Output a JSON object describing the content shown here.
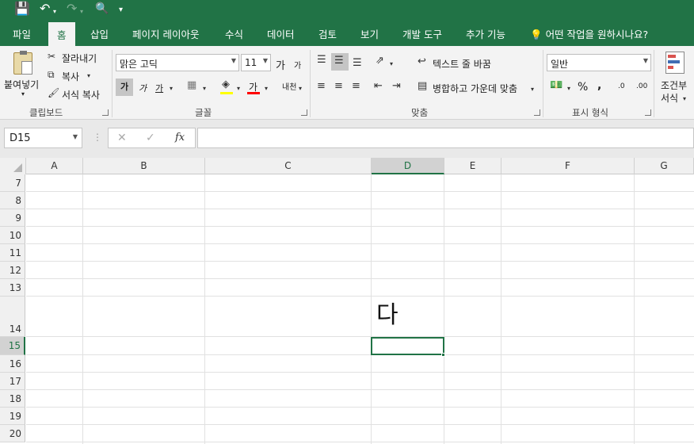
{
  "quick_access": {
    "save_icon": "save-icon",
    "undo_icon": "undo-icon",
    "redo_icon": "redo-icon",
    "preview_icon": "print-preview-icon",
    "customize_icon": "customize-icon"
  },
  "tabs": [
    "파일",
    "홈",
    "삽입",
    "페이지 레이아웃",
    "수식",
    "데이터",
    "검토",
    "보기",
    "개발 도구",
    "추가 기능"
  ],
  "tell_me": "어떤 작업을 원하시나요?",
  "clipboard": {
    "paste": "붙여넣기",
    "cut": "잘라내기",
    "copy": "복사",
    "format_painter": "서식 복사",
    "group": "클립보드"
  },
  "font": {
    "name": "맑은 고딕",
    "size": "11",
    "grow": "가",
    "shrink": "가",
    "bold": "가",
    "italic": "가",
    "underline": "가",
    "color": "가",
    "phonetic": "내천",
    "group": "글꼴"
  },
  "alignment": {
    "wrap_text": "텍스트 줄 바꿈",
    "merge_center": "병합하고 가운데 맞춤",
    "group": "맞춤"
  },
  "number": {
    "format": "일반",
    "percent": "%",
    "comma": ",",
    "increase_decimal": ".0",
    "decrease_decimal": ".00",
    "group": "표시 형식"
  },
  "styles": {
    "conditional_line1": "조건부",
    "conditional_line2": "서식"
  },
  "formula_bar": {
    "name_box": "D15",
    "fx": "fx",
    "cancel": "✕",
    "enter": "✓",
    "value": ""
  },
  "columns": [
    "A",
    "B",
    "C",
    "D",
    "E",
    "F",
    "G"
  ],
  "rows": [
    "7",
    "8",
    "9",
    "10",
    "11",
    "12",
    "13",
    "14",
    "15",
    "16",
    "17",
    "18",
    "19",
    "20"
  ],
  "cells": {
    "D14": "다"
  },
  "colors": {
    "accent": "#217346",
    "highlight_yellow": "#ffff00",
    "font_red": "#ff0000"
  }
}
